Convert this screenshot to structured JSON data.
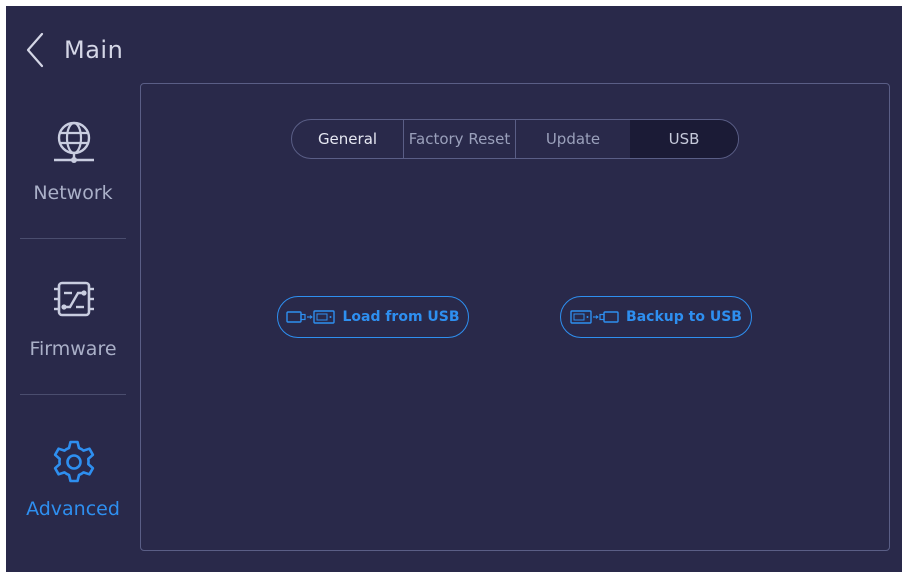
{
  "header": {
    "back_icon": "chevron-left-icon",
    "title": "Main"
  },
  "sidebar": {
    "items": [
      {
        "label": "Network",
        "icon": "globe-network-icon",
        "active": false
      },
      {
        "label": "Firmware",
        "icon": "circuit-board-icon",
        "active": false
      },
      {
        "label": "Advanced",
        "icon": "gear-icon",
        "active": true
      }
    ]
  },
  "tabs": [
    {
      "label": "General",
      "selected": false
    },
    {
      "label": "Factory Reset",
      "selected": false
    },
    {
      "label": "Update",
      "selected": false
    },
    {
      "label": "USB",
      "selected": true
    }
  ],
  "usb_actions": {
    "load": {
      "label": "Load from USB",
      "icon": "usb-to-device-icon"
    },
    "backup": {
      "label": "Backup to USB",
      "icon": "device-to-usb-icon"
    }
  },
  "colors": {
    "background": "#29294a",
    "accent": "#2e8ff0",
    "text": "#aab0c8",
    "border": "#5a5e86",
    "selected_tab": "#1b1b36"
  }
}
